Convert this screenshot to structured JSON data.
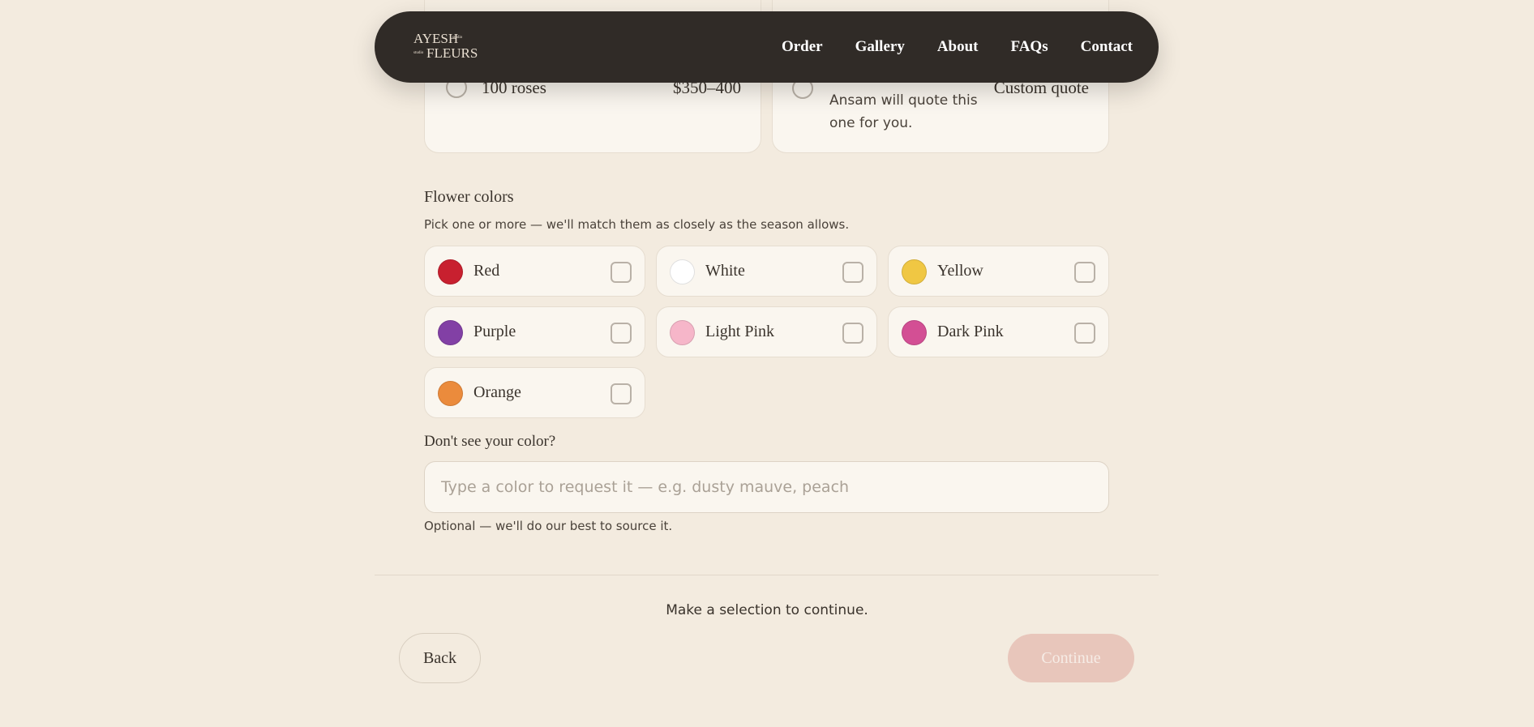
{
  "nav": {
    "logo": {
      "line1": "AYESH",
      "line2": "FLEURS",
      "small1": "studio",
      "small2": "studio"
    },
    "links": [
      "Order",
      "Gallery",
      "About",
      "FAQs",
      "Contact"
    ]
  },
  "sizes": {
    "left": {
      "label": "100 roses",
      "price": "$350–400"
    },
    "right": {
      "price": "Custom quote",
      "note": "Ansam will quote this one for you."
    }
  },
  "colors_section": {
    "title": "Flower colors",
    "subtitle": "Pick one or more — we'll match them as closely as the season allows.",
    "options": [
      {
        "name": "Red",
        "swatch": "#c8202f"
      },
      {
        "name": "White",
        "swatch": "#ffffff"
      },
      {
        "name": "Yellow",
        "swatch": "#f0c743"
      },
      {
        "name": "Purple",
        "swatch": "#8240a5"
      },
      {
        "name": "Light Pink",
        "swatch": "#f6b6c9"
      },
      {
        "name": "Dark Pink",
        "swatch": "#d34f94"
      },
      {
        "name": "Orange",
        "swatch": "#eb8b3c"
      }
    ]
  },
  "custom_color": {
    "label": "Don't see your color?",
    "placeholder": "Type a color to request it — e.g. dusty mauve, peach",
    "value": "",
    "help": "Optional — we'll do our best to source it."
  },
  "footer": {
    "status": "Make a selection to continue.",
    "back_label": "Back",
    "continue_label": "Continue"
  }
}
